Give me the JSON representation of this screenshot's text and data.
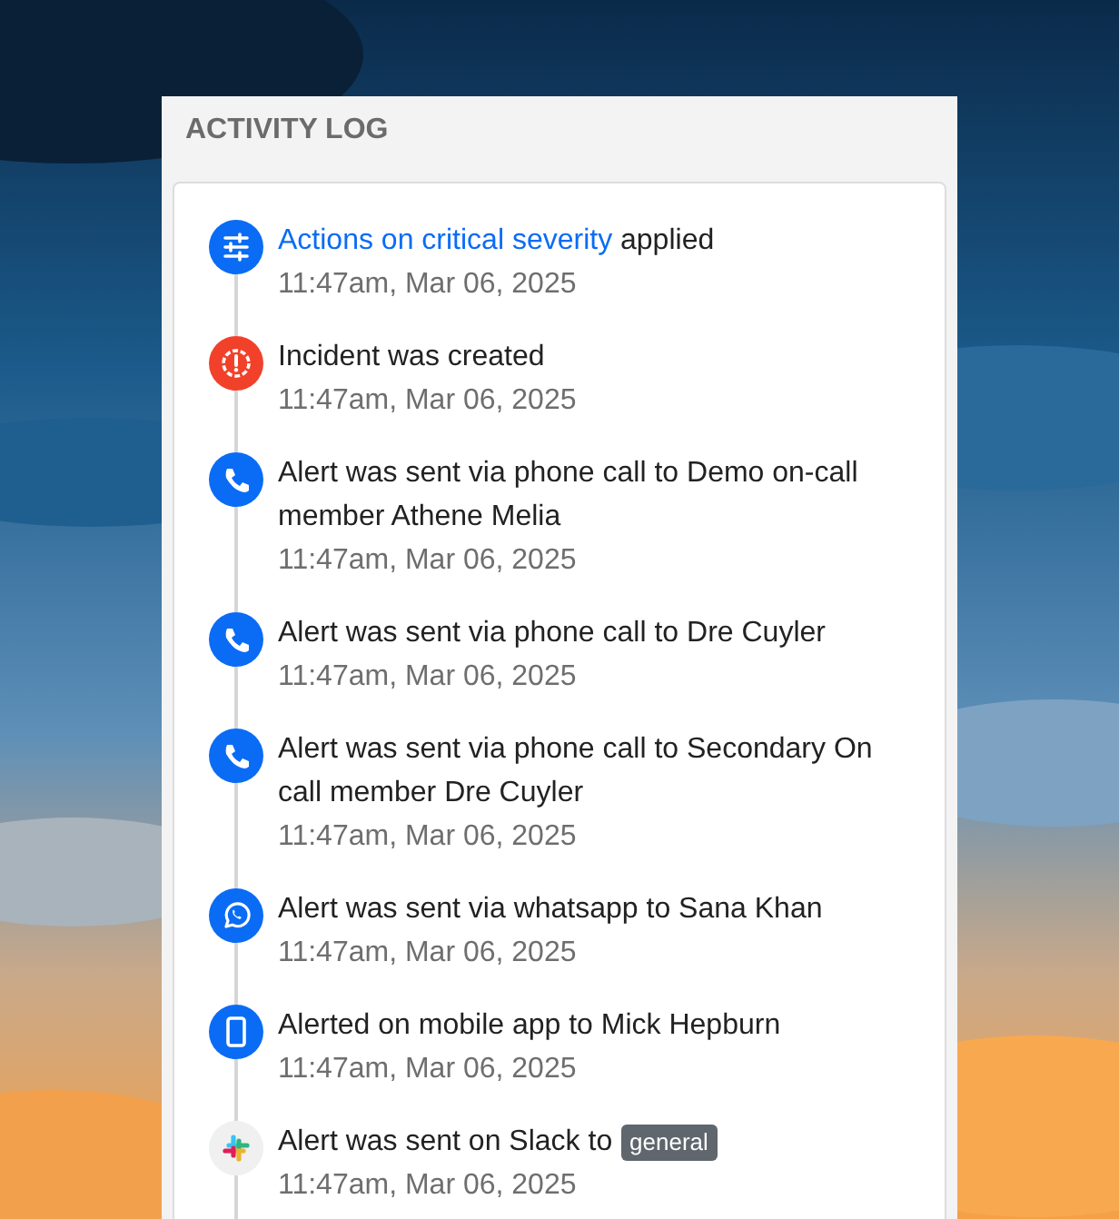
{
  "panel": {
    "title": "ACTIVITY LOG"
  },
  "entries": [
    {
      "kind": "settings",
      "link": "Actions on critical severity",
      "text": " applied",
      "time": "11:47am, Mar 06, 2025"
    },
    {
      "kind": "alert",
      "text": "Incident was created",
      "time": "11:47am, Mar 06, 2025"
    },
    {
      "kind": "phone",
      "text": "Alert was sent via phone call to Demo on-call member Athene Melia",
      "time": "11:47am, Mar 06, 2025"
    },
    {
      "kind": "phone",
      "text": "Alert was sent via phone call to Dre Cuyler",
      "time": "11:47am, Mar 06, 2025"
    },
    {
      "kind": "phone",
      "text": "Alert was sent via phone call to Secondary On call member Dre Cuyler",
      "time": "11:47am, Mar 06, 2025"
    },
    {
      "kind": "whatsapp",
      "text": "Alert was sent via whatsapp to Sana Khan",
      "time": "11:47am, Mar 06, 2025"
    },
    {
      "kind": "mobile",
      "text": "Alerted on mobile app to Mick Hepburn",
      "time": "11:47am, Mar 06, 2025"
    },
    {
      "kind": "slack",
      "text": "Alert was sent on Slack to",
      "tag": "general",
      "time": "11:47am, Mar 06, 2025"
    }
  ]
}
